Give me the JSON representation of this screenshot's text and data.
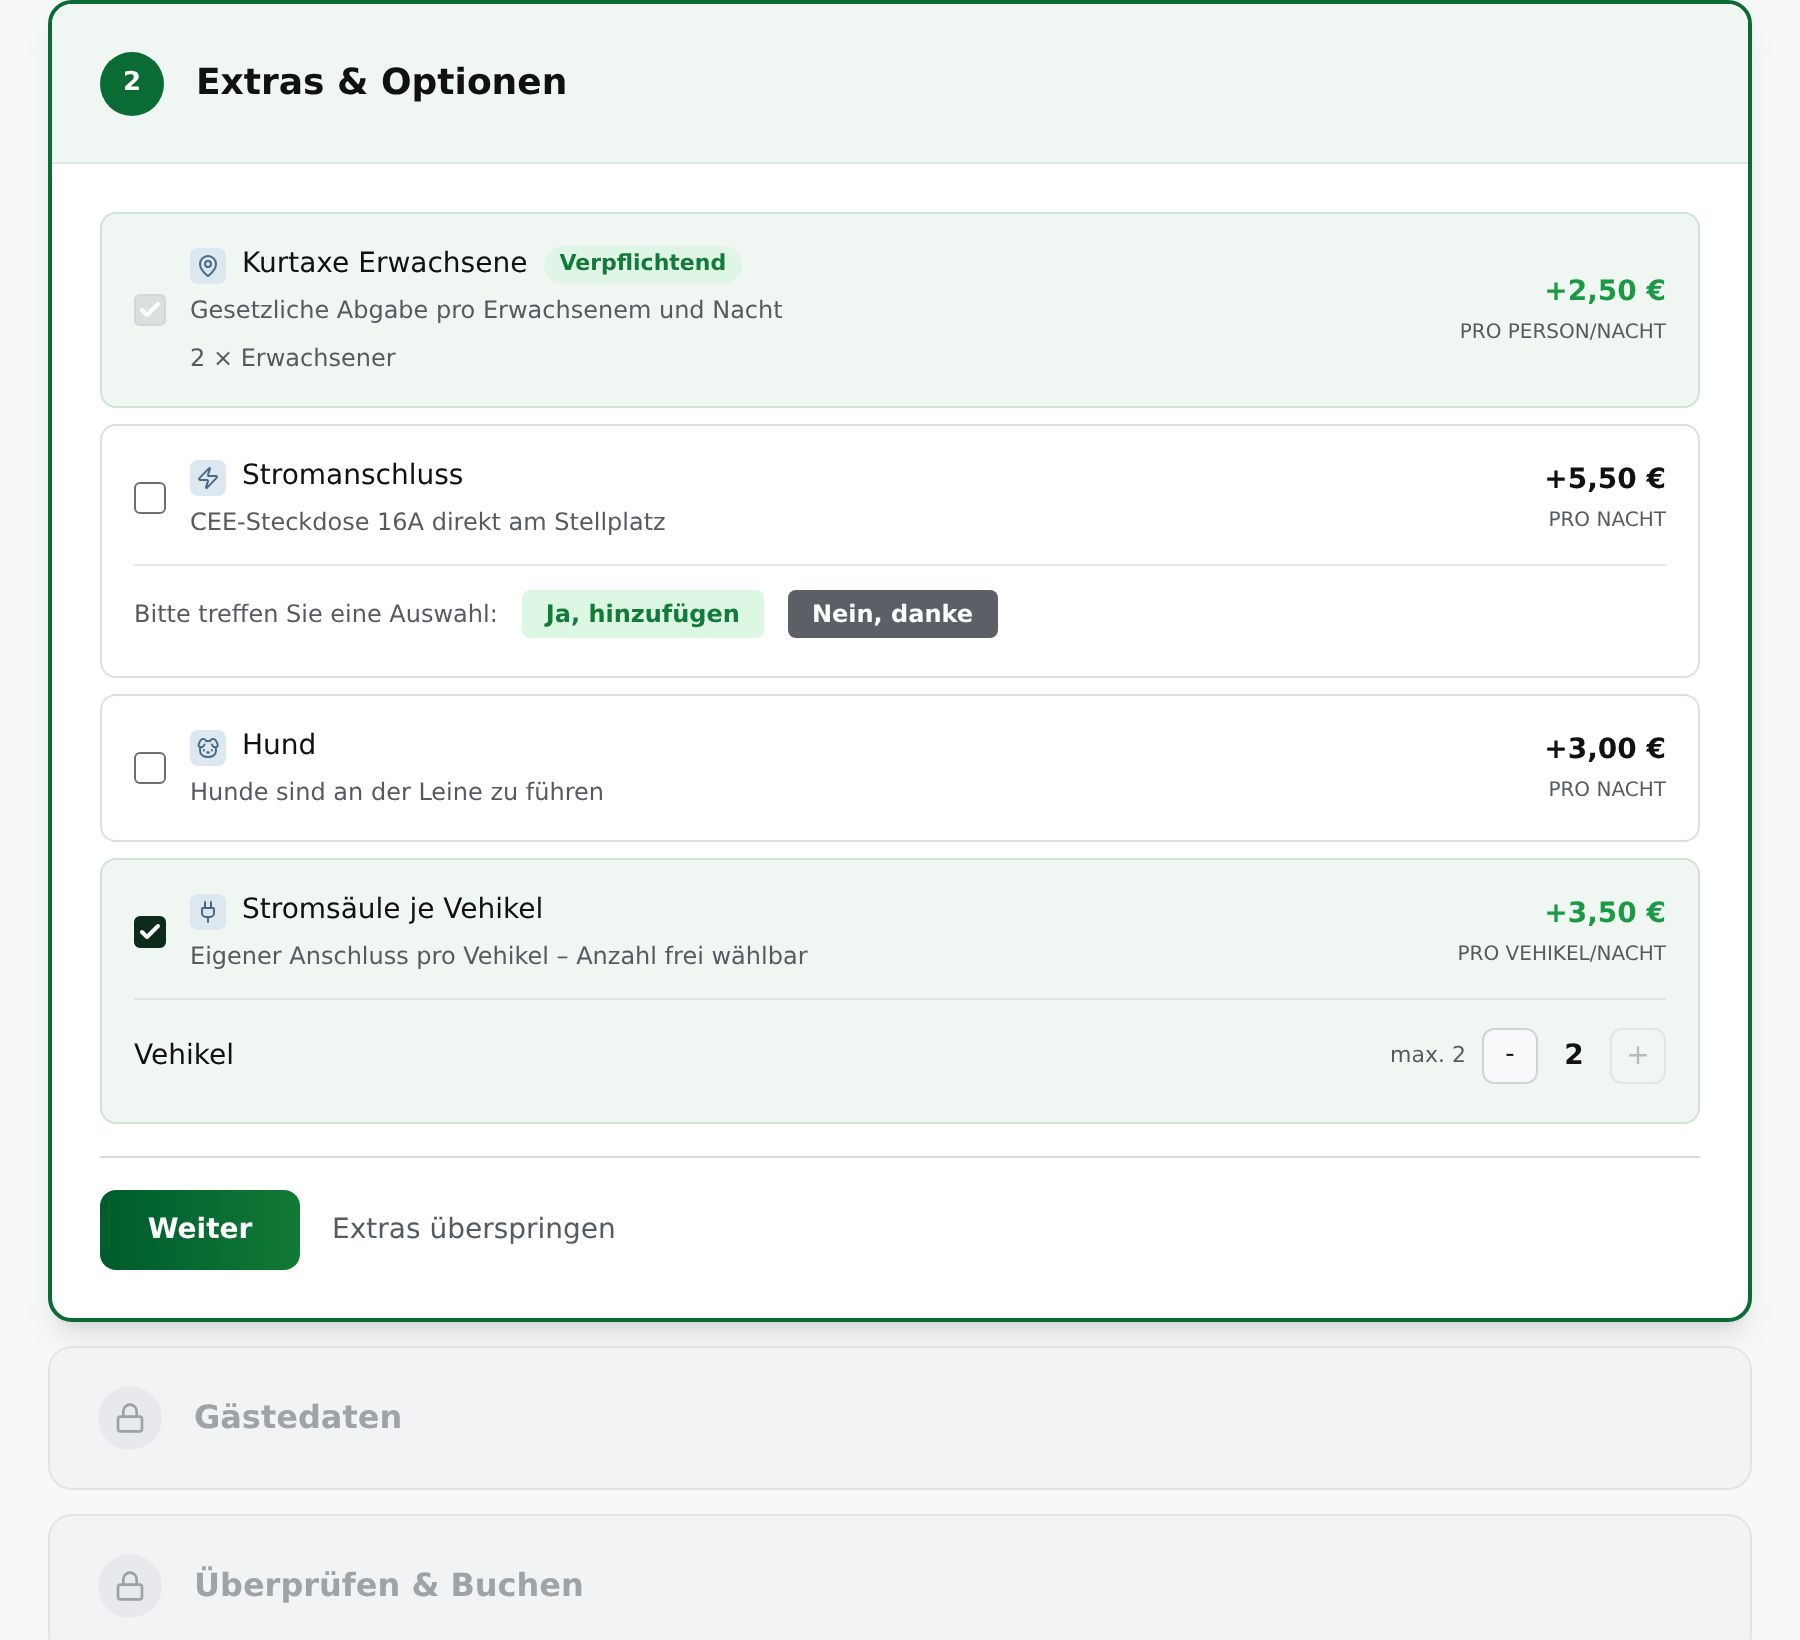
{
  "step": {
    "number": "2",
    "title": "Extras & Optionen",
    "active": true
  },
  "extras": [
    {
      "kind": "plain",
      "title": "Kurtaxe Erwachsene",
      "badge": "Verpflichtend",
      "description": "Gesetzliche Abgabe pro Erwachsenem und Nacht",
      "note": "2 × Erwachsener",
      "price": "+2,50 €",
      "unit": "PRO PERSON/NACHT",
      "checked": true,
      "disabled": true
    },
    {
      "kind": "choice",
      "title": "Stromanschluss",
      "description": "CEE-Steckdose 16A direkt am Stellplatz",
      "price": "+5,50 €",
      "unit": "PRO NACHT",
      "checked": false,
      "disabled": false,
      "prompt": "Bitte treffen Sie eine Auswahl:",
      "options": [
        {
          "kind": "accept",
          "label": "Ja, hinzufügen"
        },
        {
          "kind": "decline",
          "label": "Nein, danke"
        }
      ]
    },
    {
      "kind": "plain",
      "title": "Hund",
      "description": "Hunde sind an der Leine zu führen",
      "price": "+3,00 €",
      "unit": "PRO NACHT",
      "checked": false,
      "disabled": false
    },
    {
      "kind": "counter",
      "title": "Stromsäule je Vehikel",
      "description": "Eigener Anschluss pro Vehikel – Anzahl frei wählbar",
      "price": "+3,50 €",
      "unit": "PRO VEHIKEL/NACHT",
      "checked": true,
      "disabled": false,
      "counter": {
        "label": "Vehikel",
        "max": "max. 2",
        "minus": "-",
        "value": "2",
        "plus": "+",
        "plus_disabled": true
      }
    }
  ],
  "actions": {
    "primary": "Weiter",
    "secondary": "Extras überspringen"
  },
  "locked_steps": [
    {
      "title": "Gästedaten",
      "locked": true
    },
    {
      "title": "Überprüfen & Buchen",
      "locked": true
    }
  ]
}
